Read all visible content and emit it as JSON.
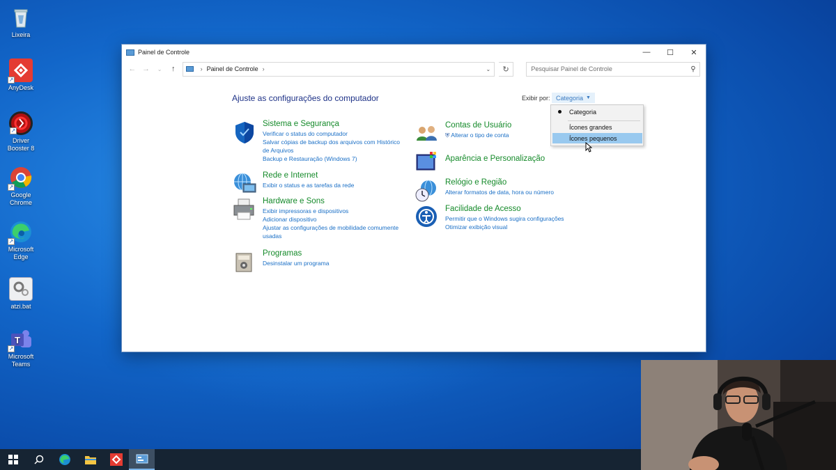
{
  "desktop": {
    "icons": [
      {
        "label": "Lixeira",
        "icon": "recycle-bin-icon"
      },
      {
        "label": "AnyDesk",
        "icon": "anydesk-icon"
      },
      {
        "label": "Driver Booster 8",
        "icon": "driver-booster-icon"
      },
      {
        "label": "Google Chrome",
        "icon": "chrome-icon"
      },
      {
        "label": "Microsoft Edge",
        "icon": "edge-icon"
      },
      {
        "label": "atzi.bat",
        "icon": "bat-file-icon"
      },
      {
        "label": "Microsoft Teams",
        "icon": "teams-icon"
      }
    ]
  },
  "window": {
    "title": "Painel de Controle",
    "controls": {
      "minimize": "—",
      "maximize": "☐",
      "close": "✕"
    },
    "address": {
      "crumb": "Painel de Controle"
    },
    "search": {
      "placeholder": "Pesquisar Painel de Controle"
    }
  },
  "content": {
    "heading": "Ajuste as configurações do computador",
    "view_by_label": "Exibir por:",
    "view_by_value": "Categoria",
    "left_categories": [
      {
        "title": "Sistema e Segurança",
        "links": [
          "Verificar o status do computador",
          "Salvar cópias de backup dos arquivos com Histórico",
          "de Arquivos",
          "Backup e Restauração (Windows 7)"
        ],
        "icon": "shield-icon"
      },
      {
        "title": "Rede e Internet",
        "links": [
          "Exibir o status e as tarefas da rede"
        ],
        "icon": "network-globe-icon"
      },
      {
        "title": "Hardware e Sons",
        "links": [
          "Exibir impressoras e dispositivos",
          "Adicionar dispositivo",
          "Ajustar as configurações de mobilidade comumente",
          "usadas"
        ],
        "icon": "printer-icon"
      },
      {
        "title": "Programas",
        "links": [
          "Desinstalar um programa"
        ],
        "icon": "programs-icon"
      }
    ],
    "right_categories": [
      {
        "title": "Contas de Usuário",
        "links": [
          "Alterar o tipo de conta"
        ],
        "icon": "users-icon"
      },
      {
        "title": "Aparência e Personalização",
        "links": [],
        "icon": "monitor-palette-icon"
      },
      {
        "title": "Relógio e Região",
        "links": [
          "Alterar formatos de data, hora ou número"
        ],
        "icon": "clock-globe-icon"
      },
      {
        "title": "Facilidade de Acesso",
        "links": [
          "Permitir que o Windows sugira configurações",
          "Otimizar exibição visual"
        ],
        "icon": "accessibility-icon"
      }
    ]
  },
  "view_menu": {
    "items": [
      {
        "label": "Categoria",
        "selected": true
      },
      {
        "label": "Ícones grandes",
        "selected": false
      },
      {
        "label": "Ícones pequenos",
        "selected": false,
        "highlighted": true
      }
    ]
  },
  "taskbar": {
    "items": [
      "start-icon",
      "search-icon",
      "edge-icon",
      "file-explorer-icon",
      "anydesk-icon",
      "control-panel-icon"
    ]
  },
  "colors": {
    "link": "#1a6fc6",
    "category_title": "#158a2a",
    "heading": "#1e3287",
    "menu_highlight": "#99c9ef"
  }
}
